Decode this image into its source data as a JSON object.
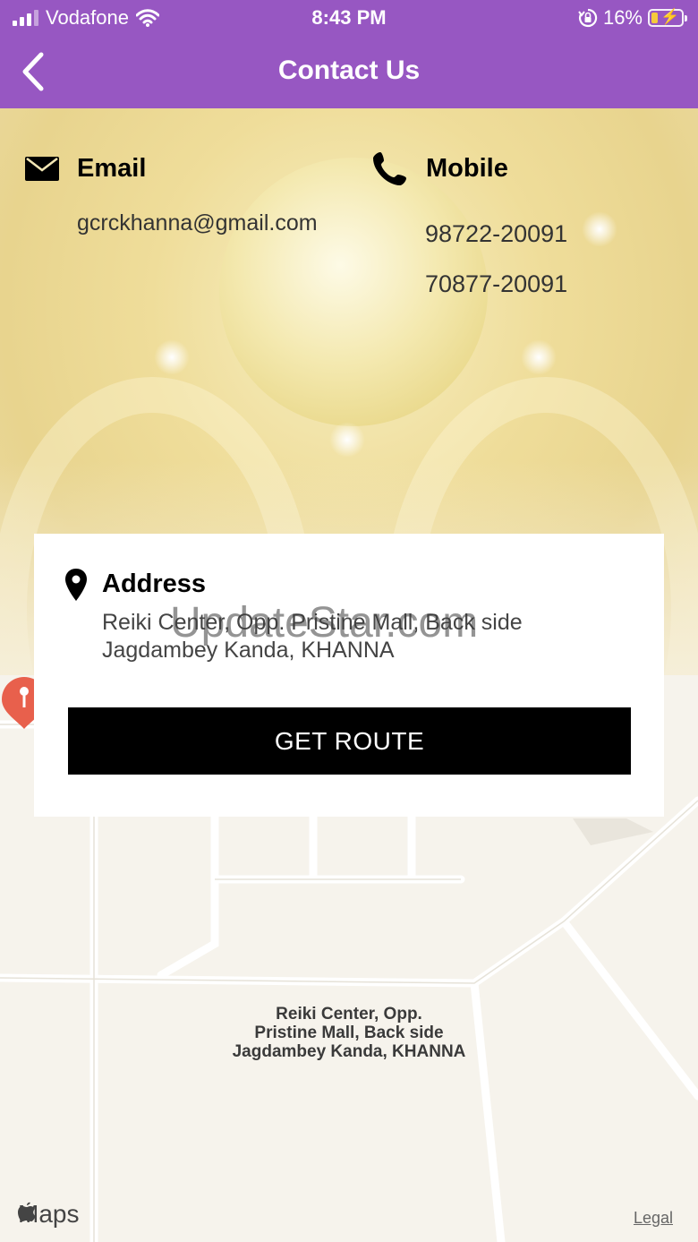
{
  "status_bar": {
    "carrier": "Vodafone",
    "time": "8:43 PM",
    "battery": "16%",
    "battery_level": 0.16
  },
  "nav": {
    "title": "Contact Us",
    "back_icon": "chevron-left-icon"
  },
  "contact": {
    "email_label": "Email",
    "email_value": "gcrckhanna@gmail.com",
    "mobile_label": "Mobile",
    "phones": [
      "98722-20091",
      "70877-20091"
    ]
  },
  "address": {
    "label": "Address",
    "text": "Reiki Center, Opp. Pristine Mall, Back side Jagdambey Kanda, KHANNA",
    "button": "GET ROUTE"
  },
  "map": {
    "pin_label": [
      "Reiki Center,  Opp.",
      "Pristine Mall, Back side",
      "Jagdambey Kanda, KHANNA"
    ],
    "maps_logo": "Maps",
    "legal": "Legal",
    "pin_color": "#e8604c"
  },
  "watermark": "UpdateStar.com",
  "colors": {
    "header": "#9757c2",
    "button": "#000000"
  }
}
